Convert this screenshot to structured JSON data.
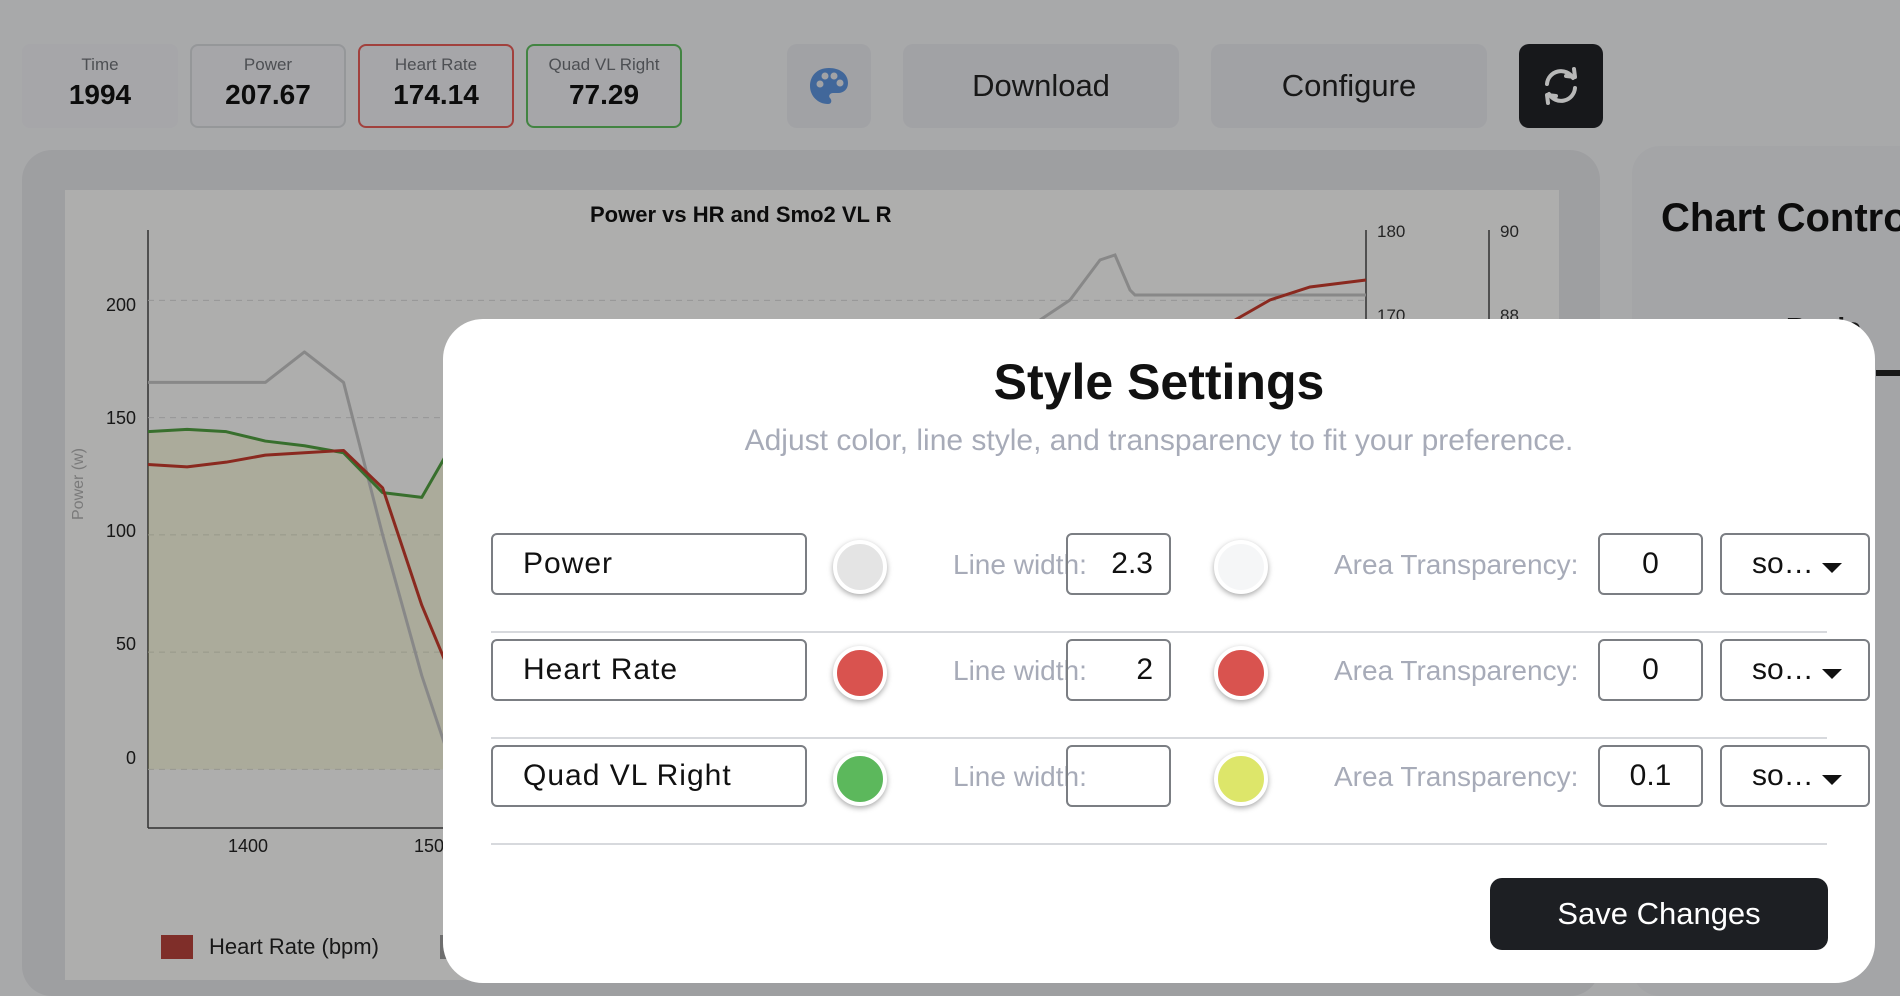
{
  "stats": [
    {
      "label": "Time",
      "value": "1994"
    },
    {
      "label": "Power",
      "value": "207.67"
    },
    {
      "label": "Heart Rate",
      "value": "174.14"
    },
    {
      "label": "Quad VL Right",
      "value": "77.29"
    }
  ],
  "toolbar": {
    "palette_icon": "palette-icon",
    "download_label": "Download",
    "configure_label": "Configure",
    "refresh_icon": "refresh-icon"
  },
  "chart": {
    "title": "Power vs HR and Smo2 VL R",
    "ylabel": "Power (w)",
    "y_ticks": [
      "200",
      "150",
      "100",
      "50",
      "0"
    ],
    "right1_ticks": [
      "180",
      "170"
    ],
    "right2_ticks": [
      "90",
      "88"
    ],
    "x_ticks": [
      "1400",
      "150"
    ],
    "legend": [
      {
        "label": "Heart Rate (bpm)",
        "color": "#b0403a"
      }
    ]
  },
  "chart_data": {
    "type": "line",
    "title": "Power vs HR and Smo2 VL R",
    "ylabel": "Power (w)",
    "x": [
      1340,
      1360,
      1380,
      1400,
      1420,
      1440,
      1460,
      1480,
      1500,
      1520
    ],
    "series": [
      {
        "name": "Power",
        "color": "#bdbdbd",
        "values": [
          165,
          165,
          165,
          165,
          178,
          165,
          100,
          40,
          -10,
          30
        ]
      },
      {
        "name": "Quad VL Right",
        "color": "#4e9a3f",
        "values": [
          144,
          145,
          144,
          140,
          138,
          135,
          118,
          116,
          145,
          170
        ]
      },
      {
        "name": "Heart Rate (bpm)",
        "color": "#c0392b",
        "values": [
          130,
          129,
          131,
          134,
          135,
          136,
          120,
          70,
          30,
          10
        ]
      }
    ],
    "ylim": [
      -25,
      230
    ],
    "xlim": [
      1340,
      1520
    ],
    "grid": true
  },
  "right_panel": {
    "title": "Chart Contro",
    "tab": "Basic"
  },
  "modal": {
    "title": "Style Settings",
    "subtitle": "Adjust color, line style, and transparency to fit your preference.",
    "line_width_label": "Line width:",
    "area_transparency_label": "Area Transparency:",
    "rows": [
      {
        "name": "Power",
        "line_color": "#e4e4e4",
        "line_width": "2.3",
        "area_color": "#f5f6f7",
        "area_transparency": "0",
        "style": "so…"
      },
      {
        "name": "Heart Rate",
        "line_color": "#d9534f",
        "line_width": "2",
        "area_color": "#d9534f",
        "area_transparency": "0",
        "style": "so…"
      },
      {
        "name": "Quad VL Right",
        "line_color": "#5cb85c",
        "line_width": "",
        "area_color": "#dde66a",
        "area_transparency": "0.1",
        "style": "so…"
      }
    ],
    "save_label": "Save Changes"
  }
}
